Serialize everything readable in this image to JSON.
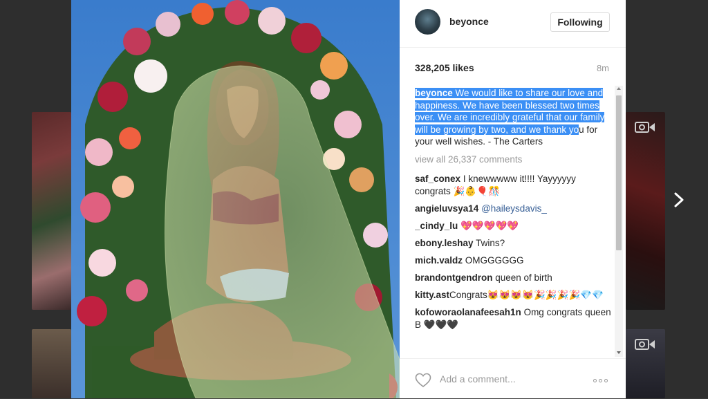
{
  "post": {
    "username": "beyonce",
    "follow_label": "Following",
    "likes": "328,205 likes",
    "time_ago": "8m",
    "caption": {
      "user": "beyonce",
      "highlighted_text": " We would like to share our love and happiness. We have been blessed two times over. We are incredibly grateful that our family will be growing by two, and we thank yo",
      "rest_text": "u for your well wishes. - The Carters"
    },
    "view_all": "view all 26,337 comments",
    "comments": [
      {
        "user": "saf_conex",
        "text": "I knewwwww it!!!! Yayyyyyy congrats 🎉👶🎈🎊"
      },
      {
        "user": "angieluvsya14",
        "mention": "@haileysdavis_",
        "text": ""
      },
      {
        "user": "_cindy_lu",
        "text": "💖💖💖💖💖"
      },
      {
        "user": "ebony.leshay",
        "text": "Twins?"
      },
      {
        "user": "mich.valdz",
        "text": "OMGGGGGG"
      },
      {
        "user": "brandontgendron",
        "text": "queen of birth"
      },
      {
        "user": "kitty.ast",
        "text": "Congrats😻😻😻😻🎉🎉🎉🎉💎💎"
      },
      {
        "user": "kofoworaolanafeesah1n",
        "text": "Omg congrats queen B 🖤🖤🖤"
      }
    ],
    "add_comment_placeholder": "Add a comment..."
  },
  "icons": {
    "heart": "heart-outline-icon",
    "more": "ellipsis-icon",
    "next": "chevron-right-icon",
    "video": "video-camera-icon"
  },
  "colors": {
    "highlight": "#3b8ff5",
    "mention": "#365e95",
    "muted": "#999999"
  }
}
